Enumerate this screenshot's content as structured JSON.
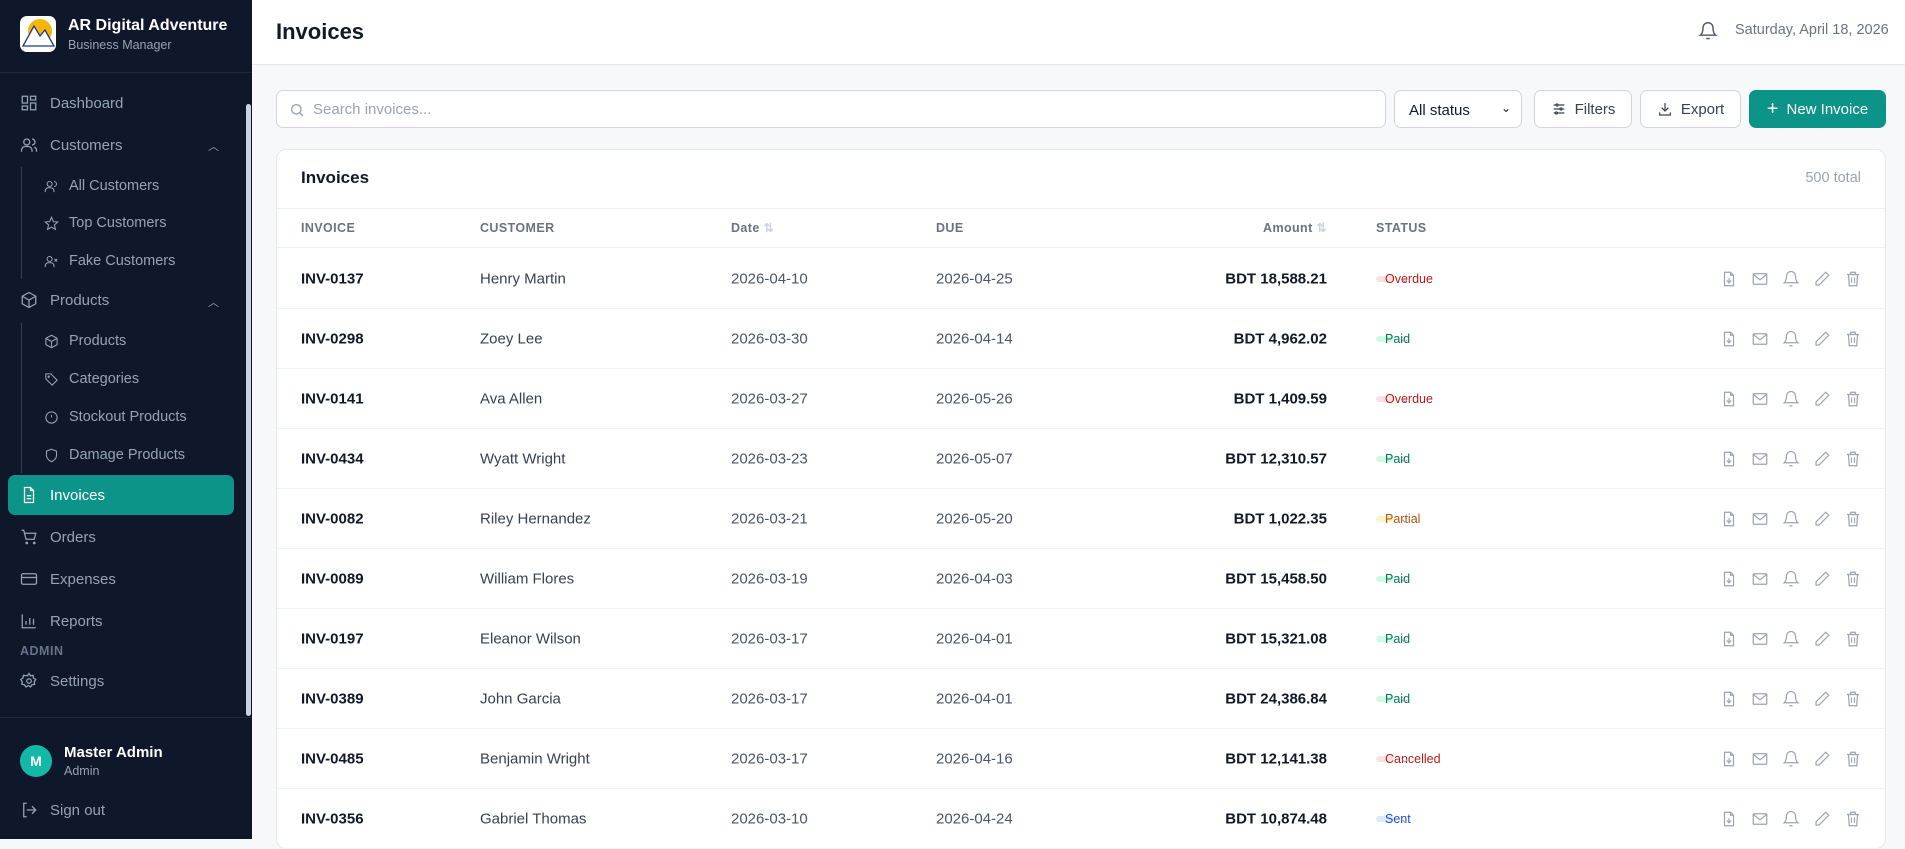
{
  "brand": {
    "name": "AR Digital Adventure",
    "subtitle": "Business Manager"
  },
  "sidebar": {
    "items": [
      {
        "label": "Dashboard",
        "icon": "dashboard-icon"
      },
      {
        "label": "Customers",
        "icon": "users-icon",
        "expanded": true,
        "children": [
          {
            "label": "All Customers",
            "icon": "users-icon"
          },
          {
            "label": "Top Customers",
            "icon": "star-icon"
          },
          {
            "label": "Fake Customers",
            "icon": "user-x-icon"
          }
        ]
      },
      {
        "label": "Products",
        "icon": "package-icon",
        "expanded": true,
        "children": [
          {
            "label": "Products",
            "icon": "package-icon"
          },
          {
            "label": "Categories",
            "icon": "tag-icon"
          },
          {
            "label": "Stockout Products",
            "icon": "alert-circle-icon"
          },
          {
            "label": "Damage Products",
            "icon": "shield-icon"
          }
        ]
      },
      {
        "label": "Invoices",
        "icon": "file-text-icon",
        "active": true
      },
      {
        "label": "Orders",
        "icon": "cart-icon"
      },
      {
        "label": "Expenses",
        "icon": "credit-card-icon"
      },
      {
        "label": "Reports",
        "icon": "bar-chart-icon"
      }
    ],
    "admin_section": "ADMIN",
    "settings": "Settings",
    "user": {
      "initial": "M",
      "name": "Master Admin",
      "role": "Admin"
    },
    "signout": "Sign out"
  },
  "header": {
    "title": "Invoices",
    "date": "Saturday, April 18, 2026"
  },
  "toolbar": {
    "search_placeholder": "Search invoices...",
    "status_select": "All status",
    "filters": "Filters",
    "export": "Export",
    "new_invoice": "New Invoice"
  },
  "colors": {
    "accent": "#0d9488",
    "sidebar": "#0f172a"
  },
  "table": {
    "title": "Invoices",
    "total": "500 total",
    "columns": [
      "INVOICE",
      "CUSTOMER",
      "Date",
      "DUE",
      "Amount",
      "STATUS"
    ],
    "rows": [
      {
        "id": "INV-0137",
        "customer": "Henry Martin",
        "date": "2026-04-10",
        "due": "2026-04-25",
        "amount": "BDT 18,588.21",
        "status": "Overdue"
      },
      {
        "id": "INV-0298",
        "customer": "Zoey Lee",
        "date": "2026-03-30",
        "due": "2026-04-14",
        "amount": "BDT 4,962.02",
        "status": "Paid"
      },
      {
        "id": "INV-0141",
        "customer": "Ava Allen",
        "date": "2026-03-27",
        "due": "2026-05-26",
        "amount": "BDT 1,409.59",
        "status": "Overdue"
      },
      {
        "id": "INV-0434",
        "customer": "Wyatt Wright",
        "date": "2026-03-23",
        "due": "2026-05-07",
        "amount": "BDT 12,310.57",
        "status": "Paid"
      },
      {
        "id": "INV-0082",
        "customer": "Riley Hernandez",
        "date": "2026-03-21",
        "due": "2026-05-20",
        "amount": "BDT 1,022.35",
        "status": "Partial"
      },
      {
        "id": "INV-0089",
        "customer": "William Flores",
        "date": "2026-03-19",
        "due": "2026-04-03",
        "amount": "BDT 15,458.50",
        "status": "Paid"
      },
      {
        "id": "INV-0197",
        "customer": "Eleanor Wilson",
        "date": "2026-03-17",
        "due": "2026-04-01",
        "amount": "BDT 15,321.08",
        "status": "Paid"
      },
      {
        "id": "INV-0389",
        "customer": "John Garcia",
        "date": "2026-03-17",
        "due": "2026-04-01",
        "amount": "BDT 24,386.84",
        "status": "Paid"
      },
      {
        "id": "INV-0485",
        "customer": "Benjamin Wright",
        "date": "2026-03-17",
        "due": "2026-04-16",
        "amount": "BDT 12,141.38",
        "status": "Cancelled"
      },
      {
        "id": "INV-0356",
        "customer": "Gabriel Thomas",
        "date": "2026-03-10",
        "due": "2026-04-24",
        "amount": "BDT 10,874.48",
        "status": "Sent"
      }
    ]
  },
  "status_colors": {
    "Overdue": [
      "#fee2e2",
      "#b91c1c"
    ],
    "Paid": [
      "#d1fae5",
      "#047857"
    ],
    "Partial": [
      "#fef3c7",
      "#b45309"
    ],
    "Cancelled": [
      "#fee2e2",
      "#b91c1c"
    ],
    "Sent": [
      "#dbeafe",
      "#1d4ed8"
    ]
  }
}
